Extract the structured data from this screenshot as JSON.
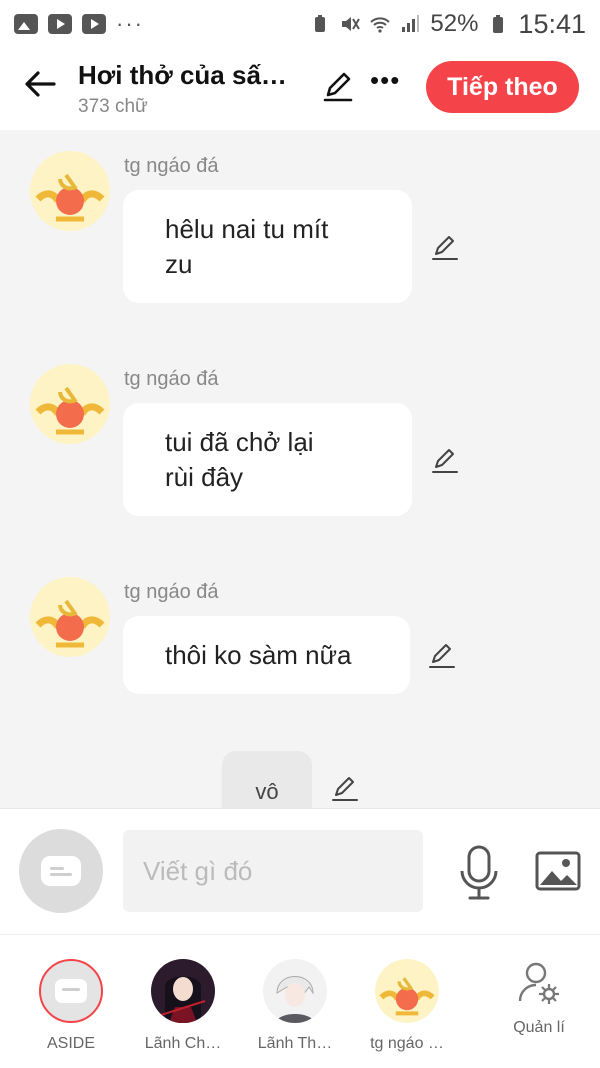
{
  "status": {
    "battery": "52%",
    "time": "15:41"
  },
  "header": {
    "title": "Hơi thở của sấ…",
    "subtitle": "373 chữ",
    "next_label": "Tiếp theo"
  },
  "messages": [
    {
      "author": "tg ngáo đá",
      "line1": "hêlu nai tu mít",
      "line2": "zu"
    },
    {
      "author": "tg ngáo đá",
      "line1": "tui đã chở lại",
      "line2": "rùi đây"
    },
    {
      "author": "tg ngáo đá",
      "line1": "thôi ko sàm nữa",
      "line2": ""
    }
  ],
  "aside_text": "vô",
  "composer": {
    "placeholder": "Viết gì đó"
  },
  "characters": [
    {
      "label": "ASIDE"
    },
    {
      "label": "Lãnh Ch…"
    },
    {
      "label": "Lãnh Th…"
    },
    {
      "label": "tg ngáo …"
    }
  ],
  "manage_label": "Quản lí",
  "colors": {
    "accent": "#f4444a",
    "background": "#f4f4f4"
  },
  "icons": [
    "back-arrow-icon",
    "pencil-icon",
    "more-icon",
    "mic-icon",
    "image-icon",
    "chat-bubble-icon",
    "user-settings-icon"
  ]
}
